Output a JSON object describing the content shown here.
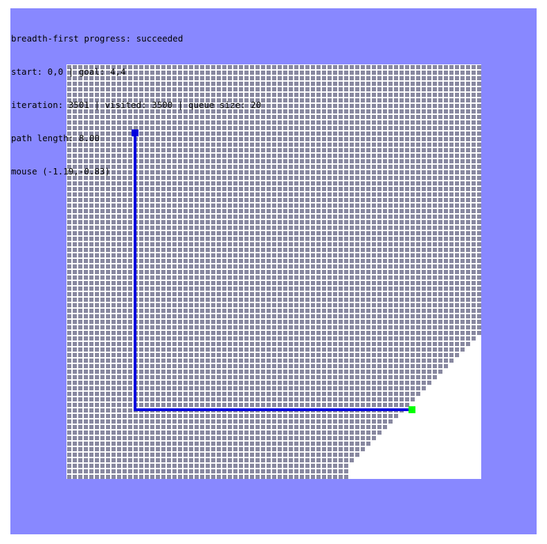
{
  "status": {
    "progress_line": "breadth-first progress: succeeded",
    "endpoints_line": "start: 0,0 | goal: 4,4",
    "counters_line": "iteration: 3501 | visited: 3500 | queue size: 20",
    "path_line": "path length: 8.00",
    "mouse_line": "mouse (-1.19,-0.83)"
  },
  "search": {
    "algorithm": "breadth-first",
    "result": "succeeded",
    "start": [
      0,
      0
    ],
    "goal": [
      4,
      4
    ],
    "iteration": 3501,
    "visited": 3500,
    "queue_size": 20,
    "path_length": 8.0,
    "mouse": [
      -1.19,
      -0.83
    ]
  },
  "colors": {
    "background": "#8888ff",
    "grid_background": "#ffffff",
    "visited_cell": "#8888a0",
    "path": "#0000dd",
    "start_marker": "#0000dd",
    "goal_marker": "#00ff00"
  }
}
